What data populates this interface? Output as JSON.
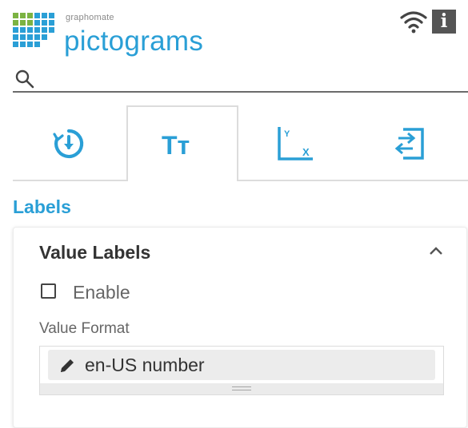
{
  "header": {
    "brand_small": "graphomate",
    "brand_name": "pictograms",
    "logo_color": "#2a9fd6",
    "logo_accent": "#7cb342",
    "icons": [
      "wifi-icon",
      "info-icon"
    ],
    "info_glyph": "i"
  },
  "search": {
    "placeholder": "",
    "value": "",
    "icon": "search-icon"
  },
  "tabs": [
    {
      "name": "tab-data",
      "icon": "download-history-icon",
      "active": false
    },
    {
      "name": "tab-labels",
      "icon": "text-size-icon",
      "glyph": "Tт",
      "active": true
    },
    {
      "name": "tab-axes",
      "icon": "axis-icon",
      "axis_x": "X",
      "axis_y": "Y",
      "active": false
    },
    {
      "name": "tab-layout",
      "icon": "import-icon",
      "active": false
    }
  ],
  "accent_color": "#2a9fd6",
  "section": {
    "title": "Labels",
    "panel": {
      "title": "Value Labels",
      "collapse_icon": "chevron-up-icon",
      "enable": {
        "label": "Enable",
        "checked": false
      },
      "value_format": {
        "label": "Value Format",
        "value": "en-US number",
        "icon": "pencil-icon"
      }
    }
  }
}
